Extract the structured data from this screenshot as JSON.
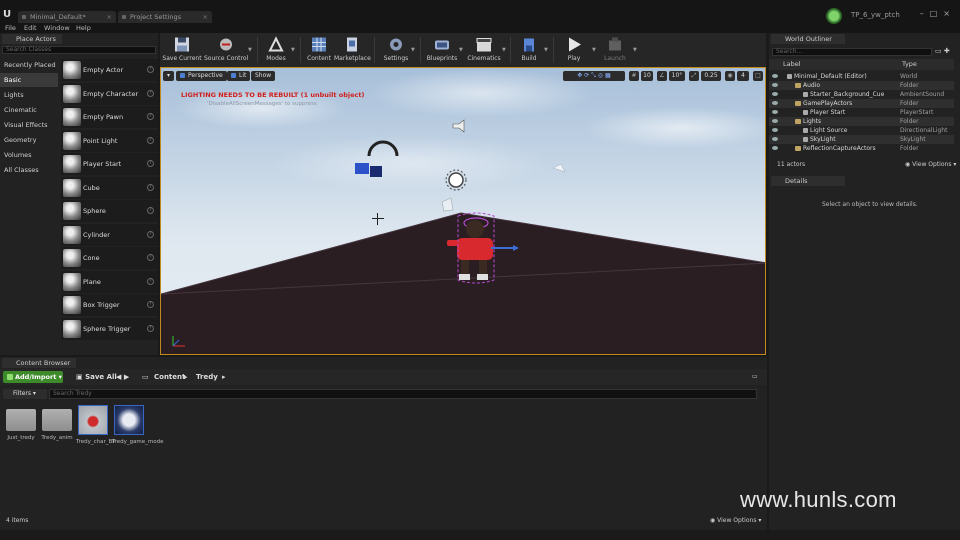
{
  "window": {
    "tabs": [
      "Minimal_Default*",
      "Project Settings"
    ],
    "project_name": "TP_6_yw_ptch"
  },
  "menu": [
    "File",
    "Edit",
    "Window",
    "Help"
  ],
  "place_actors": {
    "tab_label": "Place Actors",
    "search_placeholder": "Search Classes",
    "categories": [
      "Recently Placed",
      "Basic",
      "Lights",
      "Cinematic",
      "Visual Effects",
      "Geometry",
      "Volumes",
      "All Classes"
    ],
    "active_category": "Basic",
    "actors": [
      "Empty Actor",
      "Empty Character",
      "Empty Pawn",
      "Point Light",
      "Player Start",
      "Cube",
      "Sphere",
      "Cylinder",
      "Cone",
      "Plane",
      "Box Trigger",
      "Sphere Trigger"
    ]
  },
  "toolbar": {
    "buttons": [
      "Save Current",
      "Source Control",
      "Modes",
      "Content",
      "Marketplace",
      "Settings",
      "Blueprints",
      "Cinematics",
      "Build",
      "Play",
      "Launch"
    ]
  },
  "viewport": {
    "perspective": "Perspective",
    "lit": "Lit",
    "show": "Show",
    "grid_snap": "10",
    "rot_snap": "10°",
    "scale_snap": "0.25",
    "cam_speed": "4",
    "warning": "LIGHTING NEEDS TO BE REBUILT (1 unbuilt object)",
    "warning_sub": "'DisableAllScreenMessages' to suppress"
  },
  "world_outliner": {
    "tab_label": "World Outliner",
    "search_placeholder": "Search...",
    "col_label": "Label",
    "col_type": "Type",
    "rows": [
      {
        "name": "Minimal_Default (Editor)",
        "type": "World",
        "indent": 0,
        "kind": "world"
      },
      {
        "name": "Audio",
        "type": "Folder",
        "indent": 1,
        "kind": "folder"
      },
      {
        "name": "Starter_Background_Cue",
        "type": "AmbientSound",
        "indent": 2,
        "kind": "actor"
      },
      {
        "name": "GamePlayActors",
        "type": "Folder",
        "indent": 1,
        "kind": "folder"
      },
      {
        "name": "Player Start",
        "type": "PlayerStart",
        "indent": 2,
        "kind": "actor"
      },
      {
        "name": "Lights",
        "type": "Folder",
        "indent": 1,
        "kind": "folder"
      },
      {
        "name": "Light Source",
        "type": "DirectionalLight",
        "indent": 2,
        "kind": "actor"
      },
      {
        "name": "SkyLight",
        "type": "SkyLight",
        "indent": 2,
        "kind": "actor"
      },
      {
        "name": "ReflectionCaptureActors",
        "type": "Folder",
        "indent": 1,
        "kind": "folder"
      }
    ],
    "actor_count": "11 actors",
    "view_options": "View Options"
  },
  "details": {
    "tab_label": "Details",
    "empty_text": "Select an object to view details."
  },
  "content_browser": {
    "tab_label": "Content Browser",
    "add_import": "Add/Import",
    "save_all": "Save All",
    "path": [
      "Content",
      "Tredy"
    ],
    "filters": "Filters",
    "search_placeholder": "Search Tredy",
    "assets": [
      {
        "name": "Just_tredy",
        "kind": "folder"
      },
      {
        "name": "Tredy_anim",
        "kind": "folder"
      },
      {
        "name": "Tredy_char_BP",
        "kind": "blueprint"
      },
      {
        "name": "Tredy_game_mode",
        "kind": "gamemode"
      }
    ],
    "item_count": "4 items",
    "view_options": "View Options"
  },
  "watermark": "www.hunls.com",
  "colors": {
    "accent_green": "#3c8a2a",
    "viewport_border": "#c08a1c",
    "warning_red": "#d0201d"
  }
}
